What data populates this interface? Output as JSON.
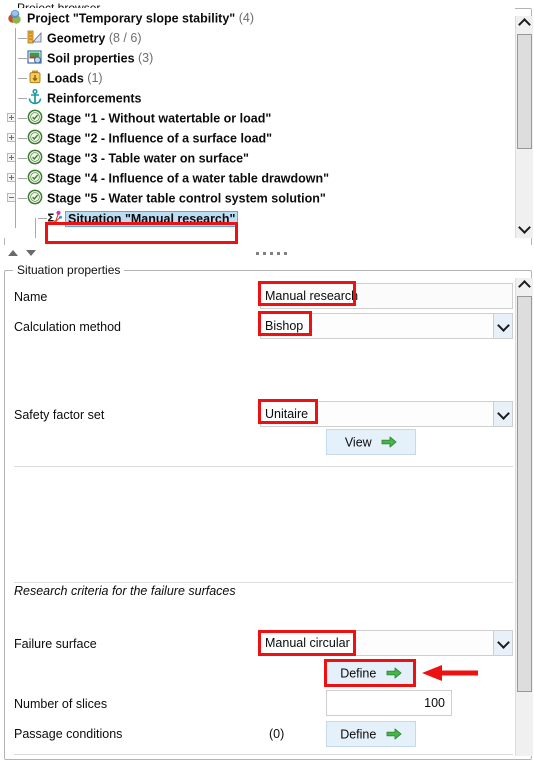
{
  "project_browser": {
    "title": "Project browser",
    "nodes": [
      {
        "label": "Project \"Temporary slope stability\"",
        "count": "(4)",
        "icon": "project-icon",
        "indent": 0,
        "expander": "none"
      },
      {
        "label": "Geometry",
        "count": "(8 / 6)",
        "icon": "geometry-icon",
        "indent": 1,
        "expander": "none"
      },
      {
        "label": "Soil properties",
        "count": "(3)",
        "icon": "soil-properties-icon",
        "indent": 1,
        "expander": "none"
      },
      {
        "label": "Loads",
        "count": "(1)",
        "icon": "loads-icon",
        "indent": 1,
        "expander": "none"
      },
      {
        "label": "Reinforcements",
        "count": "",
        "icon": "reinforcements-anchor-icon",
        "indent": 1,
        "expander": "none"
      },
      {
        "label": "Stage \"1 - Without watertable or load\"",
        "count": "",
        "icon": "stage-icon",
        "indent": 1,
        "expander": "plus"
      },
      {
        "label": "Stage \"2 - Influence of a surface load\"",
        "count": "",
        "icon": "stage-icon",
        "indent": 1,
        "expander": "plus"
      },
      {
        "label": "Stage \"3 - Table water on surface\"",
        "count": "",
        "icon": "stage-icon",
        "indent": 1,
        "expander": "plus"
      },
      {
        "label": "Stage \"4 - Influence of a water table drawdown\"",
        "count": "",
        "icon": "stage-icon",
        "indent": 1,
        "expander": "plus"
      },
      {
        "label": "Stage \"5 - Water table control system solution\"",
        "count": "",
        "icon": "stage-icon",
        "indent": 1,
        "expander": "minus"
      },
      {
        "label": "Situation \"Manual research\"",
        "count": "",
        "icon": "situation-icon",
        "indent": 2,
        "expander": "none",
        "selected": true
      }
    ]
  },
  "situation_properties": {
    "title": "Situation properties",
    "name_label": "Name",
    "name_value": "Manual research",
    "calculation_method_label": "Calculation method",
    "calculation_method_value": "Bishop",
    "safety_factor_set_label": "Safety factor set",
    "safety_factor_set_value": "Unitaire",
    "view_button_label": "View",
    "research_criteria_label": "Research criteria for the failure surfaces",
    "failure_surface_label": "Failure surface",
    "failure_surface_value": "Manual circular",
    "failure_surface_define_label": "Define",
    "number_of_slices_label": "Number of slices",
    "number_of_slices_value": "100",
    "passage_conditions_label": "Passage conditions",
    "passage_conditions_count": "(0)",
    "passage_conditions_define_label": "Define"
  },
  "colors": {
    "annotation_red": "#ee1111",
    "selection_blue": "#bcdcf4",
    "button_blue": "#e4f0fa",
    "arrow_green": "#3fae3f"
  }
}
